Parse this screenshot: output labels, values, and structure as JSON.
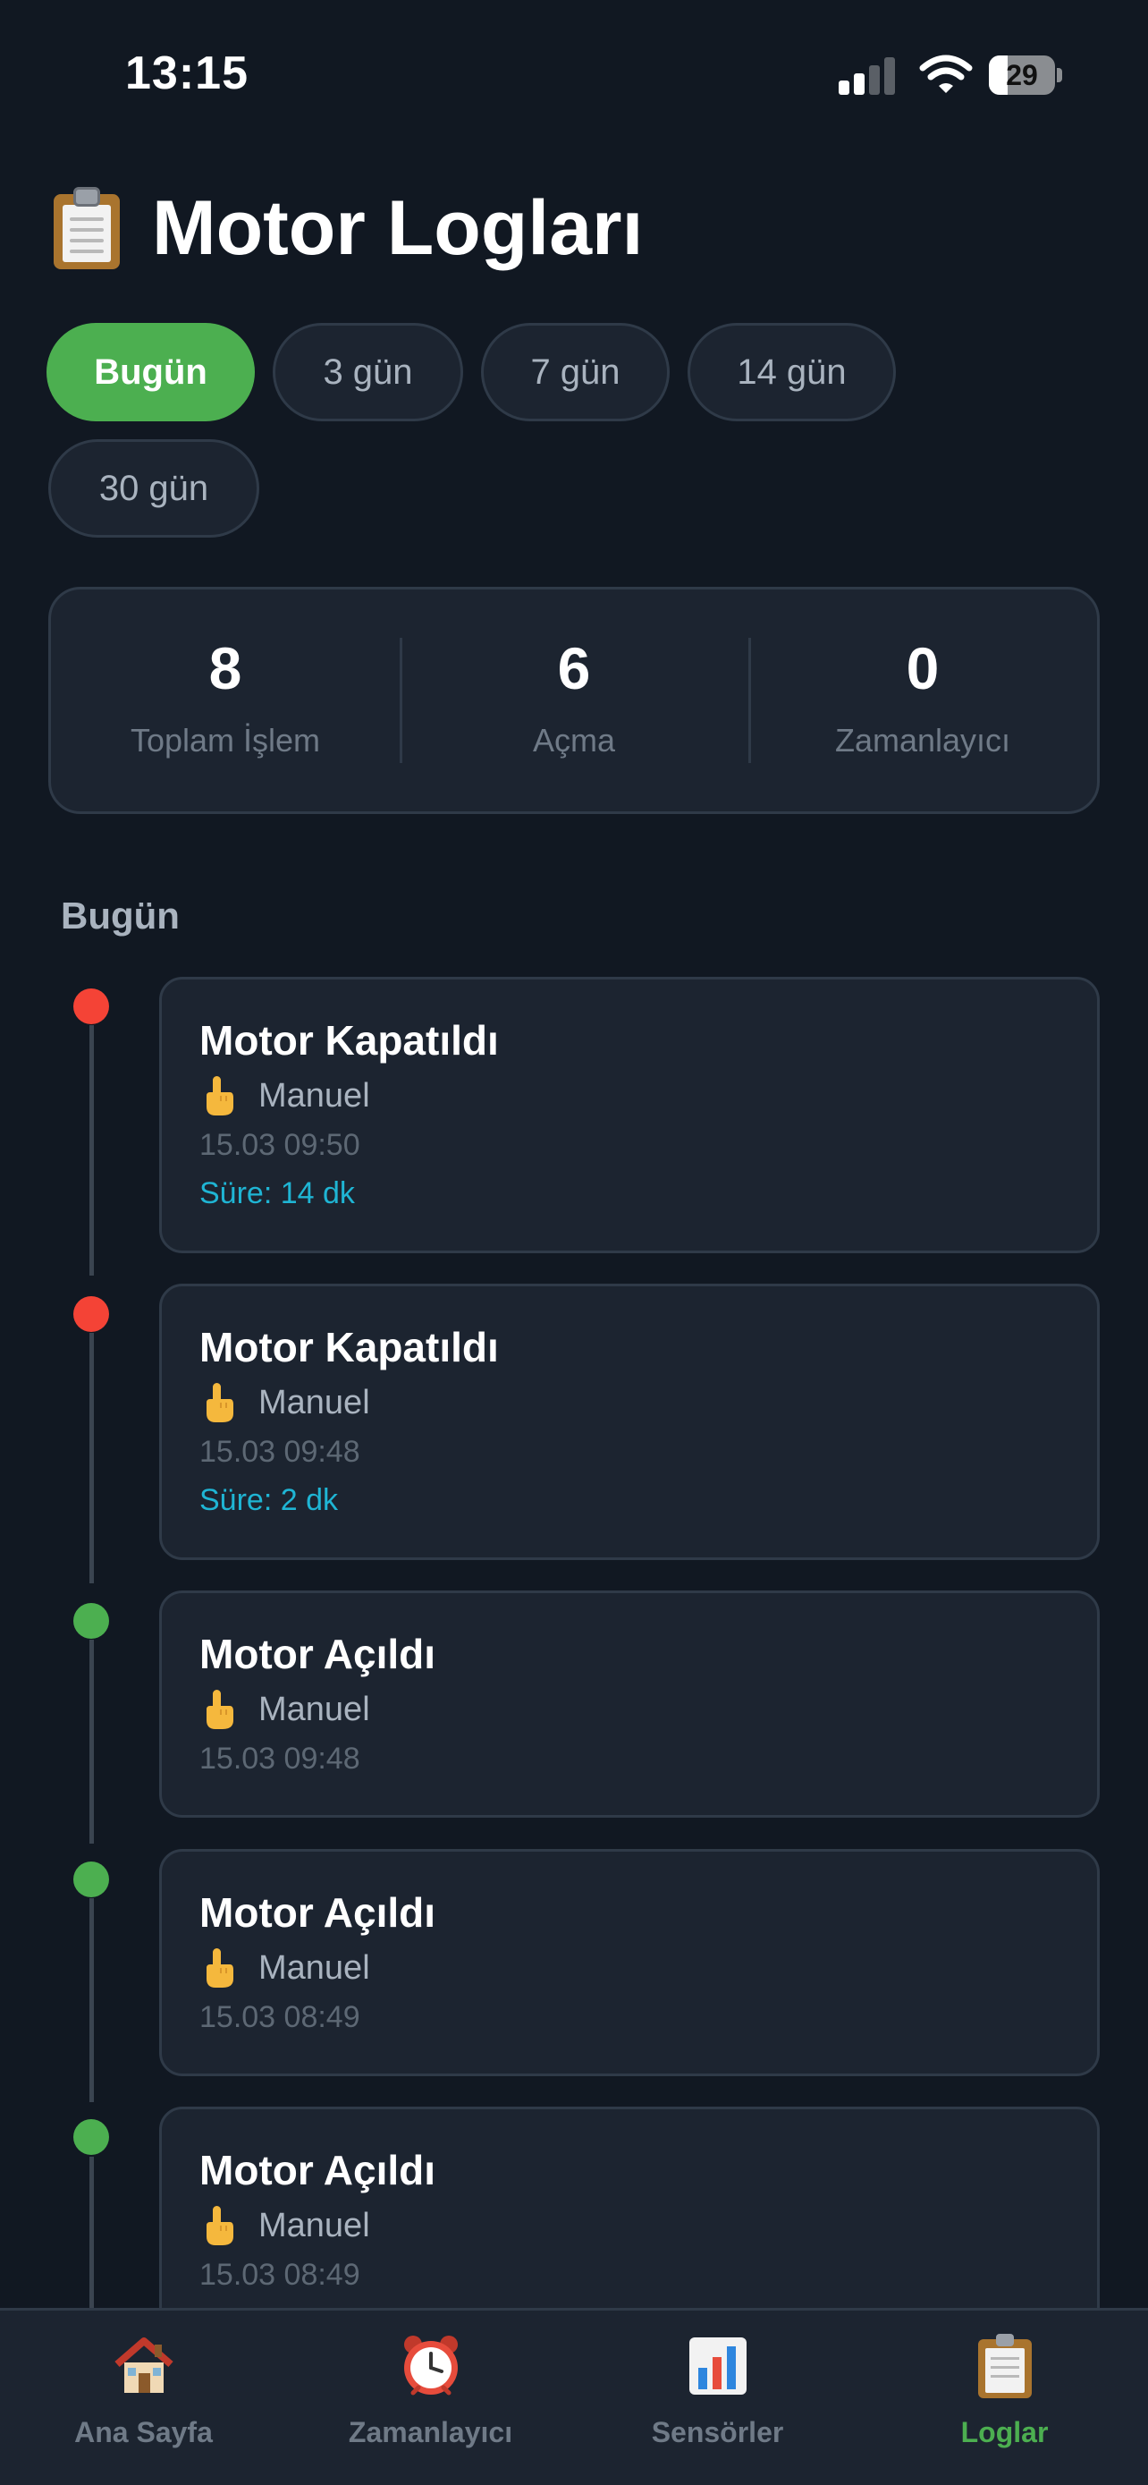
{
  "status_bar": {
    "time": "13:15",
    "battery": "29"
  },
  "header": {
    "title": "Motor Logları",
    "icon": "clipboard-icon"
  },
  "filters": [
    {
      "label": "Bugün",
      "active": true
    },
    {
      "label": "3 gün",
      "active": false
    },
    {
      "label": "7 gün",
      "active": false
    },
    {
      "label": "14 gün",
      "active": false
    },
    {
      "label": "30 gün",
      "active": false
    }
  ],
  "stats": [
    {
      "value": "8",
      "label": "Toplam İşlem"
    },
    {
      "value": "6",
      "label": "Açma"
    },
    {
      "value": "0",
      "label": "Zamanlayıcı"
    }
  ],
  "section": {
    "label": "Bugün"
  },
  "logs": [
    {
      "title": "Motor Kapatıldı",
      "source": "Manuel",
      "time": "15.03 09:50",
      "duration": "Süre: 14 dk",
      "status_color": "#f44336"
    },
    {
      "title": "Motor Kapatıldı",
      "source": "Manuel",
      "time": "15.03 09:48",
      "duration": "Süre: 2 dk",
      "status_color": "#f44336"
    },
    {
      "title": "Motor Açıldı",
      "source": "Manuel",
      "time": "15.03 09:48",
      "status_color": "#4caf50"
    },
    {
      "title": "Motor Açıldı",
      "source": "Manuel",
      "time": "15.03 08:49",
      "status_color": "#4caf50"
    },
    {
      "title": "Motor Açıldı",
      "source": "Manuel",
      "time": "15.03 08:49",
      "status_color": "#4caf50"
    }
  ],
  "tabbar": {
    "items": [
      {
        "label": "Ana Sayfa",
        "icon": "house-icon",
        "active": false
      },
      {
        "label": "Zamanlayıcı",
        "icon": "alarm-clock-icon",
        "active": false
      },
      {
        "label": "Sensörler",
        "icon": "bar-chart-icon",
        "active": false
      },
      {
        "label": "Loglar",
        "icon": "clipboard-icon",
        "active": true
      }
    ]
  },
  "colors": {
    "accent": "#4caf50",
    "background": "#111822",
    "card": "#1c2430",
    "duration": "#1fb5d4",
    "off": "#f44336"
  }
}
